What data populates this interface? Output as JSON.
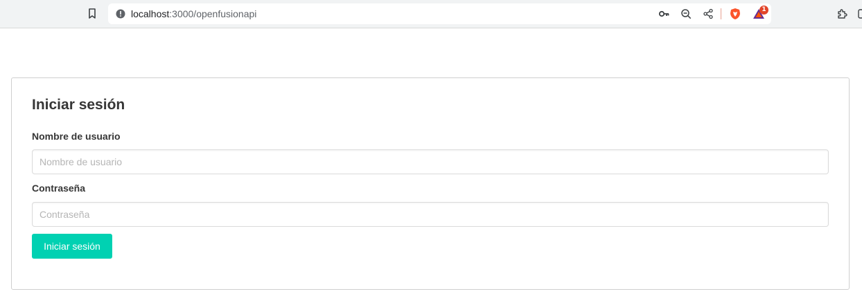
{
  "browser": {
    "url_host": "localhost",
    "url_path": ":3000/openfusionapi",
    "notification_badge": "1",
    "icons": [
      "bookmark-icon",
      "info-icon",
      "key-icon",
      "zoom-out-icon",
      "share-icon",
      "brave-shield-icon",
      "brave-rewards-icon",
      "extensions-icon",
      "sidebar-icon"
    ]
  },
  "login": {
    "title": "Iniciar sesión",
    "username_label": "Nombre de usuario",
    "username_placeholder": "Nombre de usuario",
    "username_value": "",
    "password_label": "Contraseña",
    "password_placeholder": "Contraseña",
    "password_value": "",
    "submit_label": "Iniciar sesión"
  },
  "colors": {
    "primary": "#00d1b2",
    "text": "#363636",
    "placeholder": "#b5b5b5",
    "border": "#dbdbdb"
  }
}
